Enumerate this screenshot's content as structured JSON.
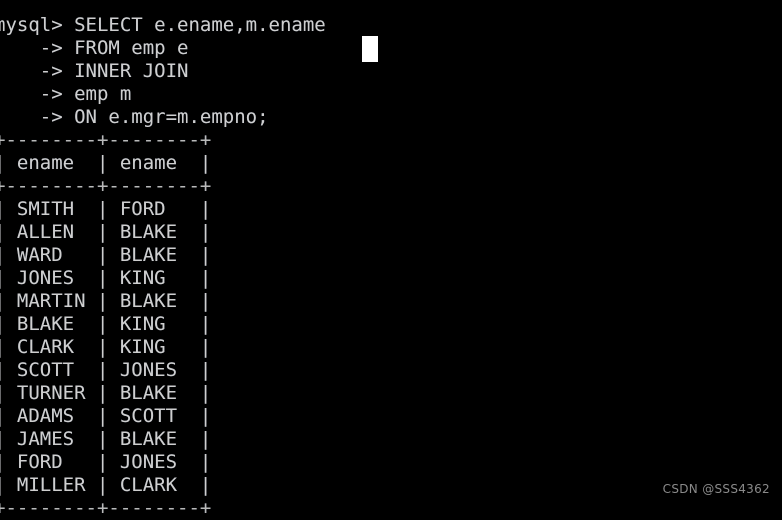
{
  "window": {
    "kind": "mysql-command-line-client",
    "background_color": "#000000",
    "foreground_color": "#cfcfcf",
    "cursor_color": "#ffffff"
  },
  "prompt": {
    "primary": "mysql>",
    "continuation": "->"
  },
  "query": {
    "lines": [
      "mysql> SELECT e.ename,m.ename",
      "    -> FROM emp e",
      "    -> INNER JOIN",
      "    -> emp m",
      "    -> ON e.mgr=m.empno;"
    ],
    "statement": "SELECT e.ename,m.ename FROM emp e INNER JOIN emp m ON e.mgr=m.empno;"
  },
  "result_table": {
    "top_rule": "+--------+--------+",
    "header_rule": "+--------+--------+",
    "bottom_rule": "+--------+--------+",
    "columns": [
      "ename",
      "ename"
    ],
    "rows": [
      [
        "SMITH",
        "FORD"
      ],
      [
        "ALLEN",
        "BLAKE"
      ],
      [
        "WARD",
        "BLAKE"
      ],
      [
        "JONES",
        "KING"
      ],
      [
        "MARTIN",
        "BLAKE"
      ],
      [
        "BLAKE",
        "KING"
      ],
      [
        "CLARK",
        "KING"
      ],
      [
        "SCOTT",
        "JONES"
      ],
      [
        "TURNER",
        "BLAKE"
      ],
      [
        "ADAMS",
        "SCOTT"
      ],
      [
        "JAMES",
        "BLAKE"
      ],
      [
        "FORD",
        "JONES"
      ],
      [
        "MILLER",
        "CLARK"
      ]
    ],
    "rendered_lines": [
      "+--------+--------+",
      "| ename  | ename  |",
      "+--------+--------+",
      "| SMITH  | FORD   |",
      "| ALLEN  | BLAKE  |",
      "| WARD   | BLAKE  |",
      "| JONES  | KING   |",
      "| MARTIN | BLAKE  |",
      "| BLAKE  | KING   |",
      "| CLARK  | KING   |",
      "| SCOTT  | JONES  |",
      "| TURNER | BLAKE  |",
      "| ADAMS  | SCOTT  |",
      "| JAMES  | BLAKE  |",
      "| FORD   | JONES  |",
      "| MILLER | CLARK  |",
      "+--------+--------+"
    ]
  },
  "background_window_fragments": [
    "•",
    "≡",
    "•",
    "≡",
    "•",
    "•",
    "≡",
    "•"
  ],
  "watermark": {
    "text": "CSDN @SSS4362"
  }
}
